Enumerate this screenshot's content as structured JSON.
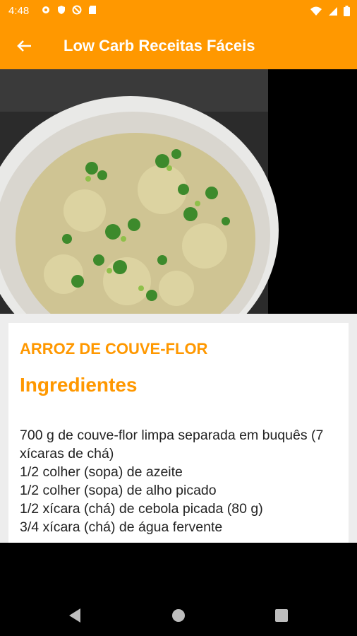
{
  "status_bar": {
    "time": "4:48",
    "left_icons": [
      "gear-icon",
      "shield-icon",
      "no-sync-icon",
      "sd-card-icon"
    ],
    "right_icons": [
      "wifi-icon",
      "signal-icon",
      "battery-icon"
    ]
  },
  "app_bar": {
    "title": "Low Carb Receitas Fáceis",
    "back_icon": "arrow-back-icon",
    "color": "#ff9800"
  },
  "recipe": {
    "title": "ARROZ DE COUVE-FLOR",
    "section_heading": "Ingredientes",
    "ingredients": [
      "700 g de couve-flor limpa separada em buquês (7 xícaras de chá)",
      "1/2 colher (sopa) de azeite",
      "1/2 colher (sopa) de alho picado",
      "1/2 xícara (chá) de cebola picada (80 g)",
      "3/4 xícara (chá) de água fervente"
    ]
  },
  "nav_bar": {
    "icons": [
      "nav-back-icon",
      "nav-home-icon",
      "nav-recents-icon"
    ]
  }
}
